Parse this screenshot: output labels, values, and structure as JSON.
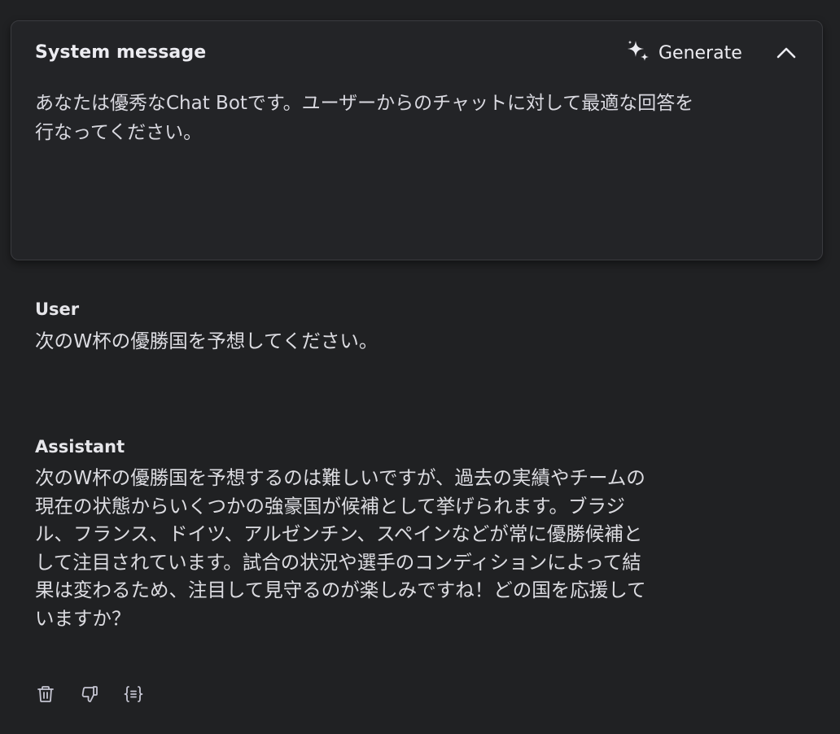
{
  "system": {
    "title": "System message",
    "generate_label": "Generate",
    "generate_icon": "sparkle-icon",
    "collapse_icon": "chevron-up-icon",
    "text": "あなたは優秀なChat Botです。ユーザーからのチャットに対して最適な回答を\n行なってください。"
  },
  "user": {
    "role": "User",
    "text": "次のW杯の優勝国を予想してください。"
  },
  "assistant": {
    "role": "Assistant",
    "text": "次のW杯の優勝国を予想するのは難しいですが、過去の実績やチームの\n現在の状態からいくつかの強豪国が候補として挙げられます。ブラジ\nル、フランス、ドイツ、アルゼンチン、スペインなどが常に優勝候補と\nして注目されています。試合の状況や選手のコンディションによって結\n果は変わるため、注目して見守るのが楽しみですね！どの国を応援して\nいますか？",
    "actions": [
      "trash-icon",
      "thumbs-down-icon",
      "code-braces-icon"
    ]
  }
}
